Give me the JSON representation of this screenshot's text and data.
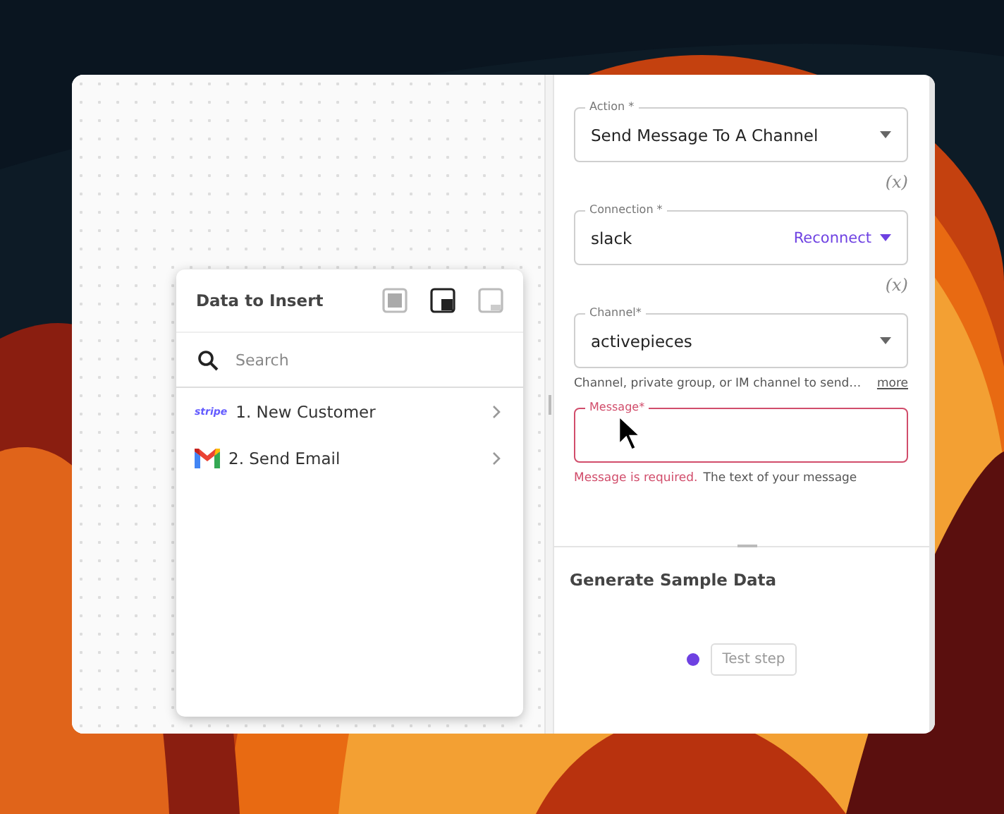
{
  "data_panel": {
    "title": "Data to Insert",
    "view_modes": [
      {
        "kind": "docked",
        "selected": false
      },
      {
        "kind": "corner",
        "selected": true
      },
      {
        "kind": "minimized",
        "selected": false
      }
    ],
    "search": {
      "placeholder": "Search"
    },
    "items": [
      {
        "kind": "stripe",
        "logo_text": "stripe",
        "label": "1. New Customer"
      },
      {
        "kind": "gmail",
        "label": "2. Send Email"
      }
    ]
  },
  "form": {
    "fields": [
      {
        "kind": "dropdown",
        "label": "Action *",
        "value": "Send Message To A Channel"
      },
      {
        "kind": "connection",
        "label": "Connection *",
        "value": "slack",
        "action": "Reconnect",
        "toggle": "(x)"
      },
      {
        "kind": "dropdown",
        "label": "Channel*",
        "value": "activepieces",
        "toggle": "(x)",
        "helper": "Channel, private group, or IM channel to send…",
        "more": "more"
      },
      {
        "kind": "text",
        "label": "Message*",
        "error": true,
        "error_text": "Message is required.",
        "helper": "The text of your message"
      }
    ]
  },
  "sample": {
    "title": "Generate Sample Data",
    "button": "Test step"
  }
}
